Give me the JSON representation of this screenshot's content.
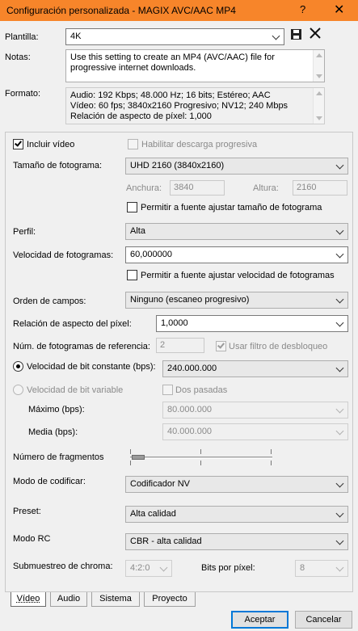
{
  "window": {
    "title": "Configuración personalizada - MAGIX AVC/AAC MP4",
    "help_icon": "?",
    "close_icon": "✕"
  },
  "plantilla": {
    "label": "Plantilla:",
    "value": "4K"
  },
  "notas": {
    "label": "Notas:",
    "value": "Use this setting to create an MP4 (AVC/AAC) file for progressive internet downloads."
  },
  "formato": {
    "label": "Formato:",
    "lines": [
      "Audio: 192 Kbps; 48.000 Hz; 16 bits; Estéreo; AAC",
      "Vídeo: 60 fps; 3840x2160 Progresivo; NV12; 240 Mbps",
      "Relación de aspecto de píxel: 1,000"
    ]
  },
  "video": {
    "incluir_video": "Incluir vídeo",
    "descarga_progresiva": "Habilitar descarga progresiva",
    "tamano_label": "Tamaño de fotograma:",
    "tamano_value": "UHD 2160 (3840x2160)",
    "anchura_label": "Anchura:",
    "anchura_value": "3840",
    "altura_label": "Altura:",
    "altura_value": "2160",
    "permitir_tamano": "Permitir a fuente ajustar tamaño de fotograma",
    "perfil_label": "Perfil:",
    "perfil_value": "Alta",
    "vel_fotogramas_label": "Velocidad de fotogramas:",
    "vel_fotogramas_value": "60,000000",
    "permitir_velocidad": "Permitir a fuente ajustar velocidad de fotogramas",
    "orden_label": "Orden de campos:",
    "orden_value": "Ninguno (escaneo progresivo)",
    "relacion_label": "Relación de aspecto del píxel:",
    "relacion_value": "1,0000",
    "num_ref_label": "Núm. de fotogramas de referencia:",
    "num_ref_value": "2",
    "usar_filtro": "Usar filtro de desbloqueo",
    "bit_constante_label": "Velocidad de bit constante (bps):",
    "bit_constante_value": "240.000.000",
    "bit_variable_label": "Velocidad de bit variable",
    "dos_pasadas": "Dos pasadas",
    "maximo_label": "Máximo (bps):",
    "maximo_value": "80.000.000",
    "media_label": "Media (bps):",
    "media_value": "40.000.000",
    "fragmentos_label": "Número de fragmentos",
    "modo_codificar_label": "Modo de codificar:",
    "modo_codificar_value": "Codificador NV",
    "preset_label": "Preset:",
    "preset_value": "Alta calidad",
    "modo_rc_label": "Modo RC",
    "modo_rc_value": "CBR - alta calidad",
    "submuestreo_label": "Submuestreo de chroma:",
    "submuestreo_value": "4:2:0",
    "bits_pixel_label": "Bits por píxel:",
    "bits_pixel_value": "8"
  },
  "tabs": [
    "Vídeo",
    "Audio",
    "Sistema",
    "Proyecto"
  ],
  "buttons": {
    "accept": "Aceptar",
    "cancel": "Cancelar"
  },
  "colors": {
    "titlebar": "#f7852a",
    "default_button_border": "#0078d7"
  }
}
